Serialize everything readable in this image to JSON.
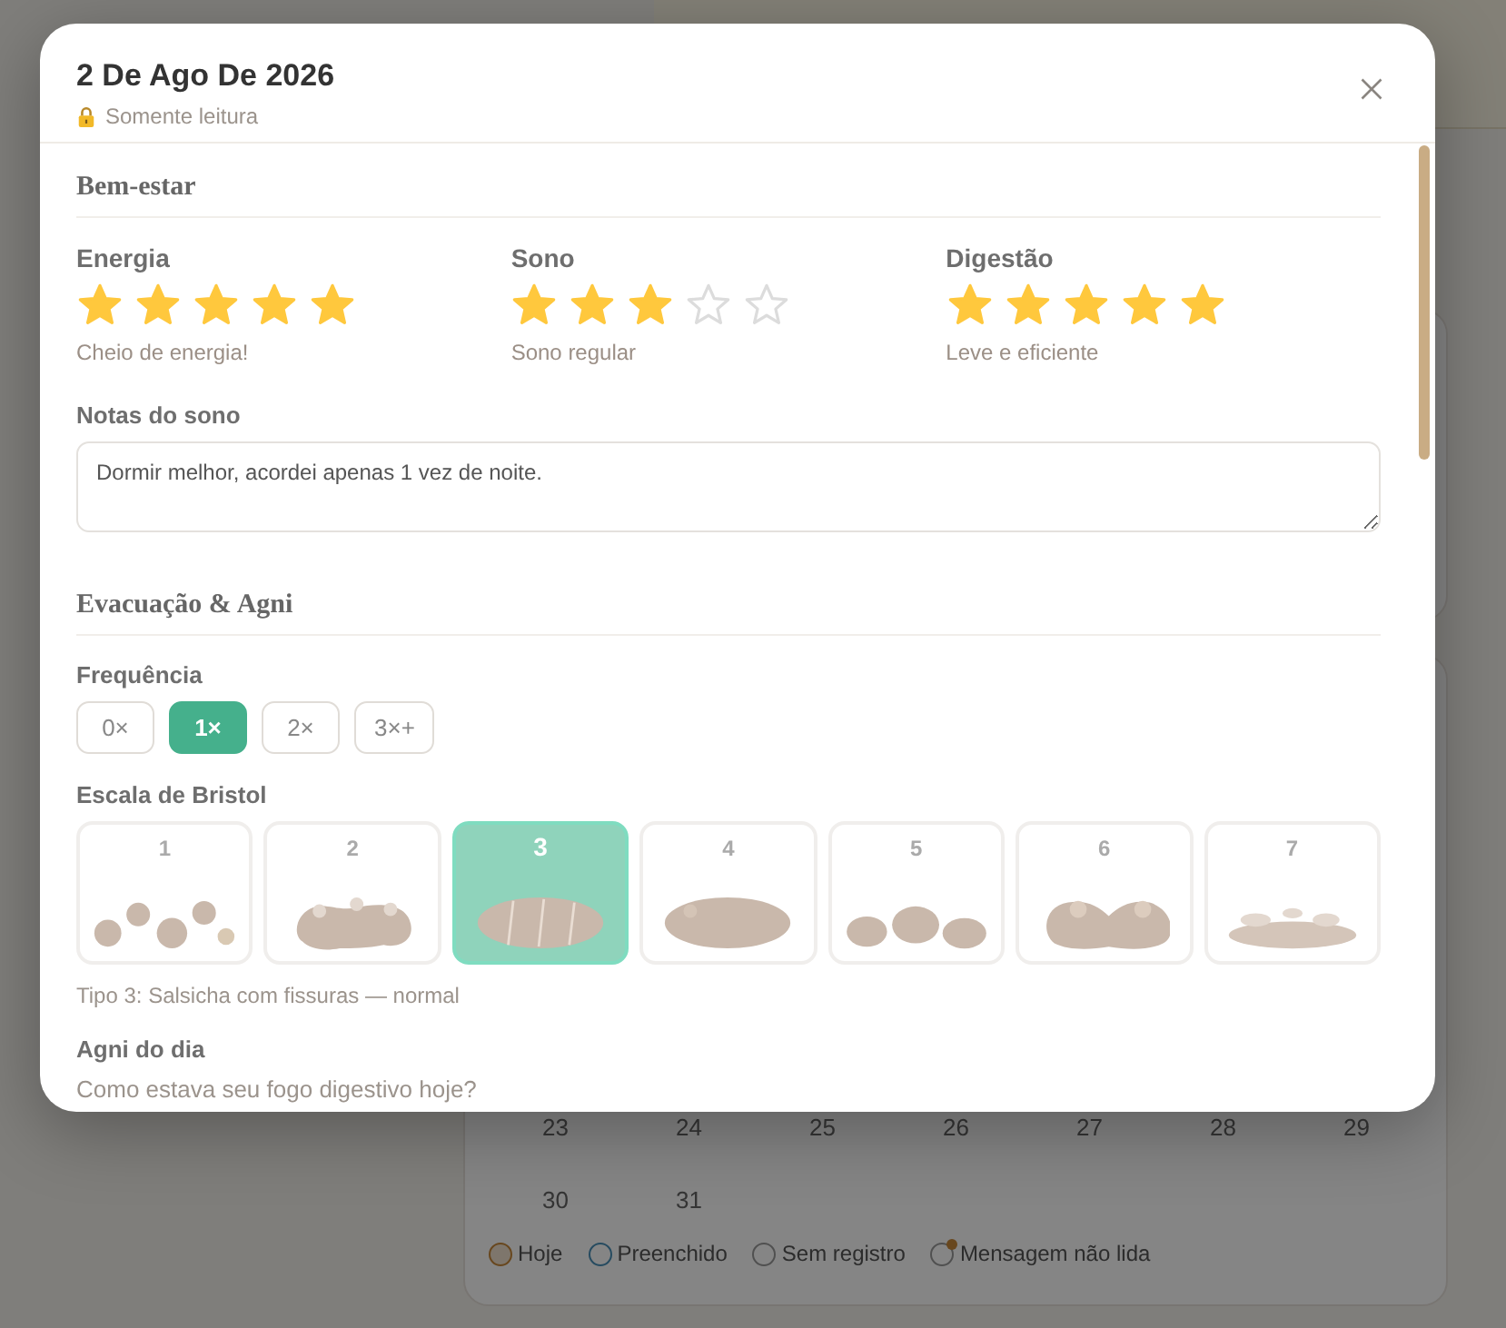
{
  "calendar": {
    "weeks": [
      [
        "23",
        "24",
        "25",
        "26",
        "27",
        "28",
        "29"
      ],
      [
        "30",
        "31"
      ]
    ],
    "legend": [
      {
        "label": "Hoje",
        "kind": "today"
      },
      {
        "label": "Preenchido",
        "kind": "filled"
      },
      {
        "label": "Sem registro",
        "kind": "empty"
      },
      {
        "label": "Mensagem não lida",
        "kind": "unread"
      }
    ]
  },
  "modal": {
    "title": "2 De Ago De 2026",
    "subtitle": "Somente leitura",
    "sections": [
      {
        "title": "Bem-estar"
      },
      {
        "title": "Evacuação & Agni"
      }
    ],
    "ratings": [
      {
        "label": "Energia",
        "stars": 5,
        "caption": "Cheio de energia!"
      },
      {
        "label": "Sono",
        "stars": 3,
        "caption": "Sono regular"
      },
      {
        "label": "Digestão",
        "stars": 5,
        "caption": "Leve e eficiente"
      }
    ],
    "sleep_notes": {
      "label": "Notas do sono",
      "value": "Dormir melhor, acordei apenas 1 vez de noite."
    },
    "frequency": {
      "label": "Frequência",
      "options": [
        {
          "label": "0×",
          "selected": false
        },
        {
          "label": "1×",
          "selected": true
        },
        {
          "label": "2×",
          "selected": false
        },
        {
          "label": "3×+",
          "selected": false
        }
      ]
    },
    "bristol": {
      "label": "Escala de Bristol",
      "options": [
        {
          "number": "1",
          "selected": false
        },
        {
          "number": "2",
          "selected": false
        },
        {
          "number": "3",
          "selected": true
        },
        {
          "number": "4",
          "selected": false
        },
        {
          "number": "5",
          "selected": false
        },
        {
          "number": "6",
          "selected": false
        },
        {
          "number": "7",
          "selected": false
        }
      ],
      "caption": "Tipo 3: Salsicha com fissuras — normal"
    },
    "agni": {
      "label": "Agni do dia",
      "question": "Como estava seu fogo digestivo hoje?"
    }
  }
}
